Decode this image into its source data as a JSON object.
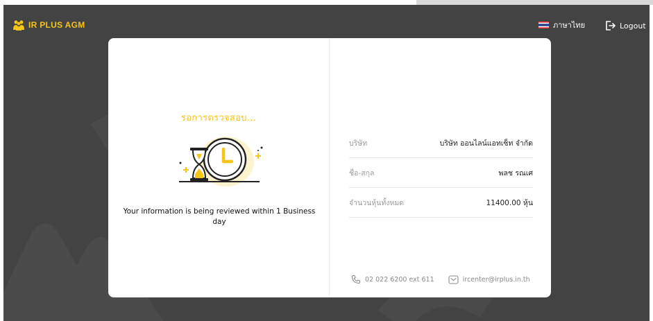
{
  "header": {
    "brand": "IR PLUS AGM",
    "language_label": "ภาษาไทย",
    "logout_label": "Logout"
  },
  "status": {
    "title": "รอการตรวจสอบ...",
    "message": "Your information is being reviewed within 1 Business day"
  },
  "details": [
    {
      "label": "บริษัท",
      "value": "บริษัท ออนไลน์แอทเซ็ท จำกัด"
    },
    {
      "label": "ชื่อ-สกุล",
      "value": "พลช รณเศ"
    },
    {
      "label": "จำนวนหุ้นทั้งหมด",
      "value": "11400.00 หุ้น"
    }
  ],
  "contact": {
    "phone": "02 022 6200 ext 611",
    "email": "ircenter@irplus.in.th"
  },
  "colors": {
    "accent": "#f5c518",
    "background": "#434343",
    "card": "#ffffff"
  },
  "icons": {
    "phone": "phone-icon",
    "email": "mail-icon",
    "logout": "logout-icon",
    "flag": "thai-flag-icon",
    "illustration": "hourglass-clock-illustration"
  }
}
